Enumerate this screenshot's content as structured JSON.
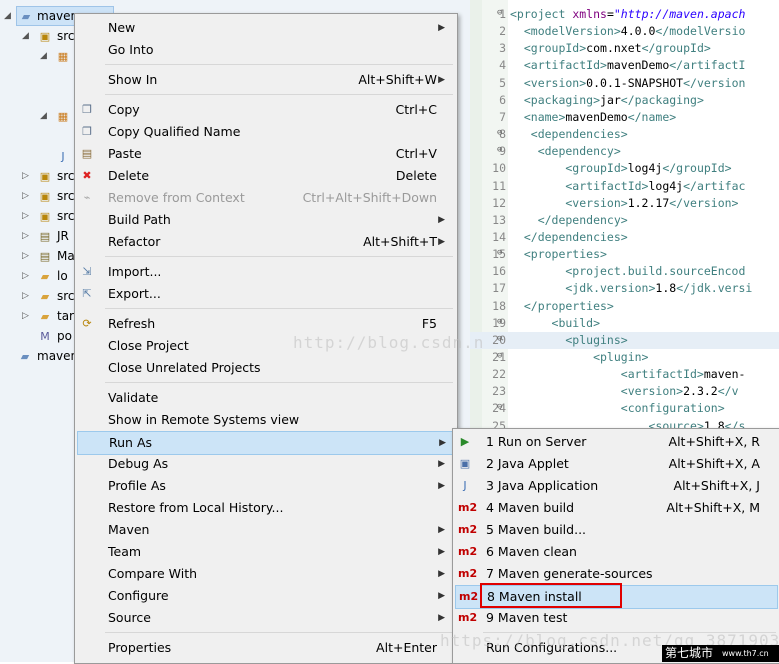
{
  "project_explorer": {
    "root_label": "maven",
    "items": [
      {
        "label": "src",
        "icon": "source-folder-icon"
      },
      {
        "label": "",
        "icon": "package-icon"
      },
      {
        "label": "",
        "icon": "package-icon"
      },
      {
        "label": "",
        "icon": "java-file-icon"
      },
      {
        "label": "src",
        "icon": "source-folder-icon"
      },
      {
        "label": "src",
        "icon": "source-folder-icon"
      },
      {
        "label": "src",
        "icon": "source-folder-icon"
      },
      {
        "label": "JR",
        "icon": "library-icon"
      },
      {
        "label": "Ma",
        "icon": "library-icon"
      },
      {
        "label": "lo",
        "icon": "folder-icon"
      },
      {
        "label": "src",
        "icon": "folder-icon"
      },
      {
        "label": "tar",
        "icon": "folder-icon"
      },
      {
        "label": "po",
        "icon": "pom-file-icon"
      },
      {
        "label": "maven",
        "icon": "project-icon"
      }
    ]
  },
  "editor": {
    "lines": [
      {
        "n": "1",
        "segs": [
          [
            "tag",
            "<project "
          ],
          [
            "attr",
            "xmlns"
          ],
          [
            "val",
            "="
          ],
          [
            "str",
            "\"http://maven.apach"
          ]
        ]
      },
      {
        "n": "2",
        "segs": [
          [
            "tag",
            "  <modelVersion>"
          ],
          [
            "val",
            "4.0.0"
          ],
          [
            "tag",
            "</modelVersio"
          ]
        ]
      },
      {
        "n": "3",
        "segs": [
          [
            "tag",
            "  <groupId>"
          ],
          [
            "val",
            "com.nxet"
          ],
          [
            "tag",
            "</groupId>"
          ]
        ]
      },
      {
        "n": "4",
        "segs": [
          [
            "tag",
            "  <artifactId>"
          ],
          [
            "val",
            "mavenDemo"
          ],
          [
            "tag",
            "</artifactI"
          ]
        ]
      },
      {
        "n": "5",
        "segs": [
          [
            "tag",
            "  <version>"
          ],
          [
            "val",
            "0.0.1-SNAPSHOT"
          ],
          [
            "tag",
            "</version"
          ]
        ]
      },
      {
        "n": "6",
        "segs": [
          [
            "tag",
            "  <packaging>"
          ],
          [
            "val",
            "jar"
          ],
          [
            "tag",
            "</packaging>"
          ]
        ]
      },
      {
        "n": "7",
        "segs": [
          [
            "tag",
            "  <name>"
          ],
          [
            "val",
            "mavenDemo"
          ],
          [
            "tag",
            "</name>"
          ]
        ]
      },
      {
        "n": "8",
        "segs": [
          [
            "tag",
            "   <dependencies>"
          ]
        ]
      },
      {
        "n": "9",
        "segs": [
          [
            "tag",
            "    <dependency>"
          ]
        ]
      },
      {
        "n": "10",
        "segs": [
          [
            "tag",
            "        <groupId>"
          ],
          [
            "val",
            "log4j"
          ],
          [
            "tag",
            "</groupId>"
          ]
        ]
      },
      {
        "n": "11",
        "segs": [
          [
            "tag",
            "        <artifactId>"
          ],
          [
            "val",
            "log4j"
          ],
          [
            "tag",
            "</artifac"
          ]
        ]
      },
      {
        "n": "12",
        "segs": [
          [
            "tag",
            "        <version>"
          ],
          [
            "val",
            "1.2.17"
          ],
          [
            "tag",
            "</version>"
          ]
        ]
      },
      {
        "n": "13",
        "segs": [
          [
            "tag",
            "    </dependency>"
          ]
        ]
      },
      {
        "n": "14",
        "segs": [
          [
            "tag",
            "  </dependencies>"
          ]
        ]
      },
      {
        "n": "15",
        "segs": [
          [
            "tag",
            "  <properties>"
          ]
        ]
      },
      {
        "n": "16",
        "segs": [
          [
            "tag",
            "        <project.build.sourceEncod"
          ]
        ]
      },
      {
        "n": "17",
        "segs": [
          [
            "tag",
            "        <jdk.version>"
          ],
          [
            "val",
            "1.8"
          ],
          [
            "tag",
            "</jdk.versi"
          ]
        ]
      },
      {
        "n": "18",
        "segs": [
          [
            "tag",
            "  </properties>"
          ]
        ]
      },
      {
        "n": "19",
        "segs": [
          [
            "tag",
            "      <build>"
          ]
        ]
      },
      {
        "n": "20",
        "segs": [
          [
            "tag",
            "        <plugins>"
          ]
        ]
      },
      {
        "n": "21",
        "segs": [
          [
            "tag",
            "            <plugin>"
          ]
        ]
      },
      {
        "n": "22",
        "segs": [
          [
            "tag",
            "                <artifactId>"
          ],
          [
            "val",
            "maven-"
          ]
        ]
      },
      {
        "n": "23",
        "segs": [
          [
            "tag",
            "                <version>"
          ],
          [
            "val",
            "2.3.2"
          ],
          [
            "tag",
            "</v"
          ]
        ]
      },
      {
        "n": "24",
        "segs": [
          [
            "tag",
            "                <configuration>"
          ]
        ]
      },
      {
        "n": "25",
        "segs": [
          [
            "tag",
            "                    <source>"
          ],
          [
            "val",
            "1.8"
          ],
          [
            "tag",
            "</s"
          ]
        ]
      }
    ]
  },
  "context_menu": {
    "items": [
      {
        "label": "New",
        "shortcut": "",
        "submenu": true,
        "icon": "",
        "name": "new"
      },
      {
        "label": "Go Into",
        "shortcut": "",
        "submenu": false,
        "icon": "",
        "name": "go-into"
      },
      {
        "sep": true
      },
      {
        "label": "Show In",
        "shortcut": "Alt+Shift+W",
        "submenu": true,
        "icon": "",
        "name": "show-in"
      },
      {
        "sep": true
      },
      {
        "label": "Copy",
        "shortcut": "Ctrl+C",
        "submenu": false,
        "icon": "copy-icon",
        "name": "copy"
      },
      {
        "label": "Copy Qualified Name",
        "shortcut": "",
        "submenu": false,
        "icon": "copy-icon",
        "name": "copy-qualified-name"
      },
      {
        "label": "Paste",
        "shortcut": "Ctrl+V",
        "submenu": false,
        "icon": "paste-icon",
        "name": "paste"
      },
      {
        "label": "Delete",
        "shortcut": "Delete",
        "submenu": false,
        "icon": "delete-icon",
        "name": "delete"
      },
      {
        "label": "Remove from Context",
        "shortcut": "Ctrl+Alt+Shift+Down",
        "submenu": false,
        "icon": "remove-icon",
        "disabled": true,
        "name": "remove-from-context"
      },
      {
        "label": "Build Path",
        "shortcut": "",
        "submenu": true,
        "icon": "",
        "name": "build-path"
      },
      {
        "label": "Refactor",
        "shortcut": "Alt+Shift+T",
        "submenu": true,
        "icon": "",
        "name": "refactor"
      },
      {
        "sep": true
      },
      {
        "label": "Import...",
        "shortcut": "",
        "submenu": false,
        "icon": "import-icon",
        "name": "import"
      },
      {
        "label": "Export...",
        "shortcut": "",
        "submenu": false,
        "icon": "export-icon",
        "name": "export"
      },
      {
        "sep": true
      },
      {
        "label": "Refresh",
        "shortcut": "F5",
        "submenu": false,
        "icon": "refresh-icon",
        "name": "refresh"
      },
      {
        "label": "Close Project",
        "shortcut": "",
        "submenu": false,
        "icon": "",
        "name": "close-project"
      },
      {
        "label": "Close Unrelated Projects",
        "shortcut": "",
        "submenu": false,
        "icon": "",
        "name": "close-unrelated-projects"
      },
      {
        "sep": true
      },
      {
        "label": "Validate",
        "shortcut": "",
        "submenu": false,
        "icon": "",
        "name": "validate"
      },
      {
        "label": "Show in Remote Systems view",
        "shortcut": "",
        "submenu": false,
        "icon": "",
        "name": "show-in-remote-systems"
      },
      {
        "label": "Run As",
        "shortcut": "",
        "submenu": true,
        "icon": "",
        "selected": true,
        "name": "run-as"
      },
      {
        "label": "Debug As",
        "shortcut": "",
        "submenu": true,
        "icon": "",
        "name": "debug-as"
      },
      {
        "label": "Profile As",
        "shortcut": "",
        "submenu": true,
        "icon": "",
        "name": "profile-as"
      },
      {
        "label": "Restore from Local History...",
        "shortcut": "",
        "submenu": false,
        "icon": "",
        "name": "restore-from-local-history"
      },
      {
        "label": "Maven",
        "shortcut": "",
        "submenu": true,
        "icon": "",
        "name": "maven"
      },
      {
        "label": "Team",
        "shortcut": "",
        "submenu": true,
        "icon": "",
        "name": "team"
      },
      {
        "label": "Compare With",
        "shortcut": "",
        "submenu": true,
        "icon": "",
        "name": "compare-with"
      },
      {
        "label": "Configure",
        "shortcut": "",
        "submenu": true,
        "icon": "",
        "name": "configure"
      },
      {
        "label": "Source",
        "shortcut": "",
        "submenu": true,
        "icon": "",
        "name": "source"
      },
      {
        "sep": true
      },
      {
        "label": "Properties",
        "shortcut": "Alt+Enter",
        "submenu": false,
        "icon": "",
        "name": "properties"
      }
    ]
  },
  "run_as_submenu": {
    "items": [
      {
        "label": "1 Run on Server",
        "shortcut": "Alt+Shift+X, R",
        "icon": "server-icon",
        "name": "run-on-server"
      },
      {
        "label": "2 Java Applet",
        "shortcut": "Alt+Shift+X, A",
        "icon": "applet-icon",
        "name": "java-applet"
      },
      {
        "label": "3 Java Application",
        "shortcut": "Alt+Shift+X, J",
        "icon": "java-app-icon",
        "name": "java-application"
      },
      {
        "label": "4 Maven build",
        "shortcut": "Alt+Shift+X, M",
        "icon": "m2-icon",
        "name": "maven-build"
      },
      {
        "label": "5 Maven build...",
        "shortcut": "",
        "icon": "m2-icon",
        "name": "maven-build-dialog"
      },
      {
        "label": "6 Maven clean",
        "shortcut": "",
        "icon": "m2-icon",
        "name": "maven-clean"
      },
      {
        "label": "7 Maven generate-sources",
        "shortcut": "",
        "icon": "m2-icon",
        "name": "maven-generate-sources"
      },
      {
        "label": "8 Maven install",
        "shortcut": "",
        "icon": "m2-icon",
        "name": "maven-install",
        "highlighted": true
      },
      {
        "label": "9 Maven test",
        "shortcut": "",
        "icon": "m2-icon",
        "name": "maven-test"
      },
      {
        "sep": true
      },
      {
        "label": "Run Configurations...",
        "shortcut": "",
        "icon": "",
        "name": "run-configurations"
      }
    ]
  },
  "watermarks": [
    "http://blog.csdn.n",
    "https://blog.csdn.net/qq_38719039"
  ],
  "logo": {
    "text_cn": "第七城市",
    "text_en": "www.th7.cn"
  },
  "colors": {
    "menu_bg": "#f0f0f0",
    "selection": "#cce4f7",
    "highlight_box": "#e00000",
    "m2_red": "#c00000",
    "xml_tag": "#3f7f7f"
  }
}
